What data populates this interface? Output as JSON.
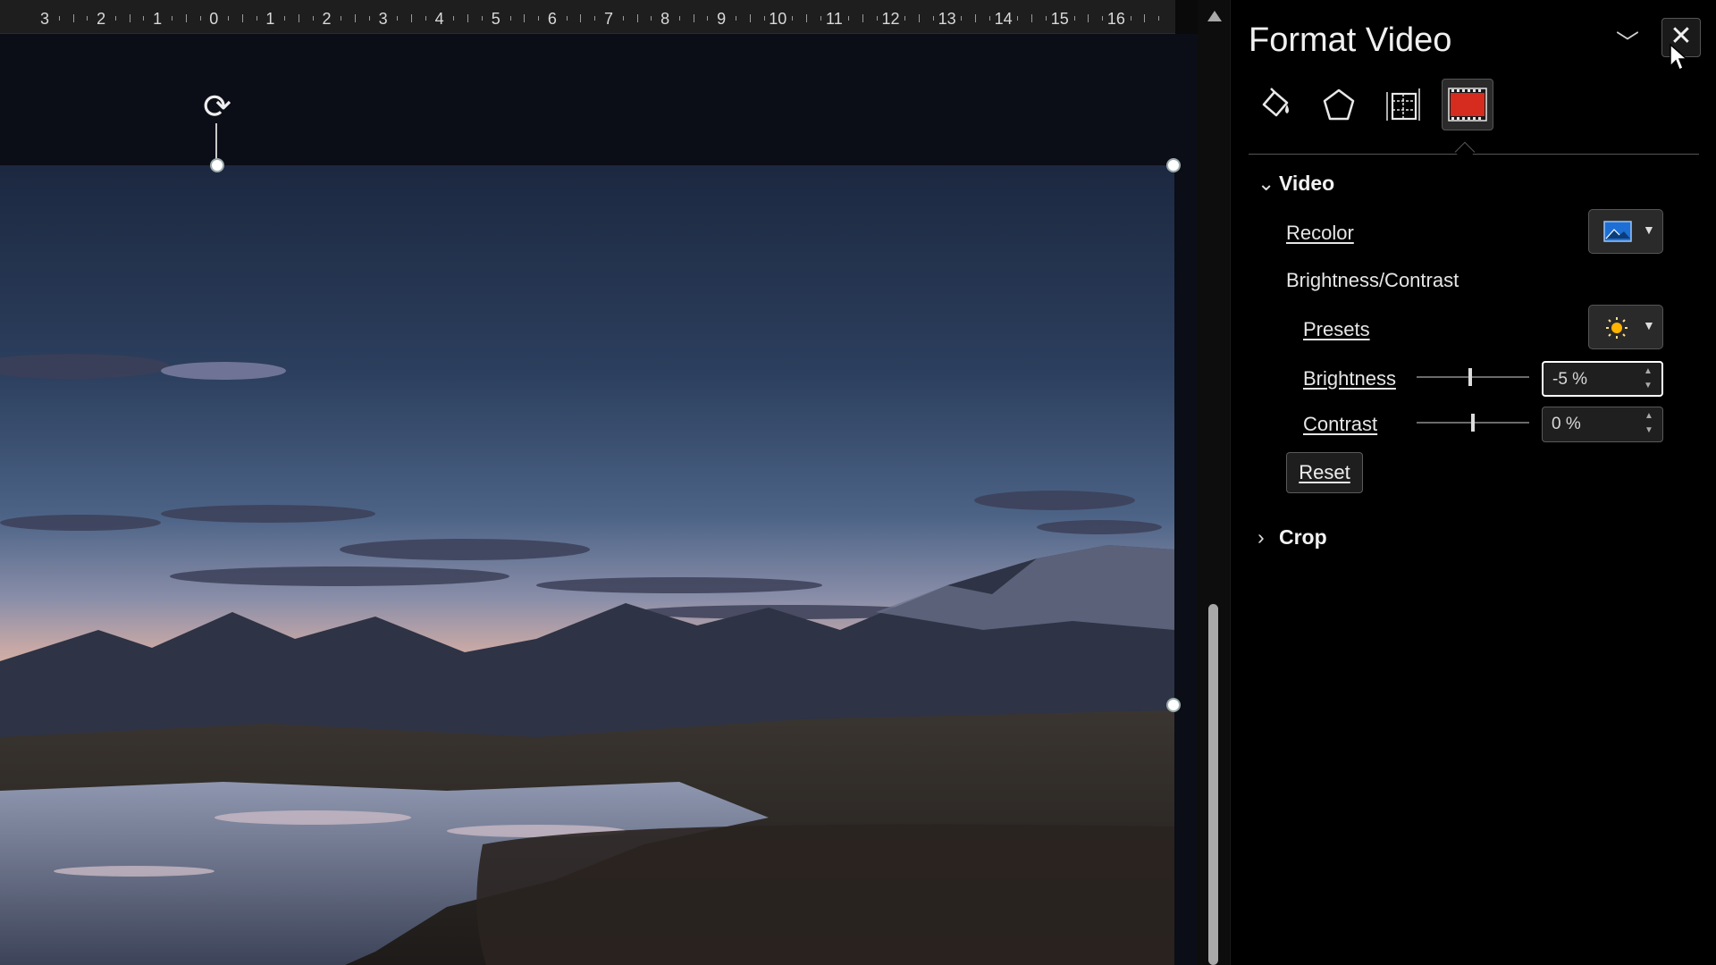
{
  "ruler": {
    "labels": [
      "3",
      "2",
      "1",
      "0",
      "1",
      "2",
      "3",
      "4",
      "5",
      "6",
      "7",
      "8",
      "9",
      "10",
      "11",
      "12",
      "13",
      "14",
      "15",
      "16"
    ]
  },
  "panel": {
    "title": "Format Video",
    "tabs": [
      {
        "icon": "fill-line-icon"
      },
      {
        "icon": "effects-pentagon-icon"
      },
      {
        "icon": "size-properties-icon"
      },
      {
        "icon": "video-icon",
        "active": true
      }
    ],
    "video_section": {
      "label": "Video",
      "expanded": true,
      "recolor_label": "Recolor",
      "brightness_contrast_label": "Brightness/Contrast",
      "presets_label": "Presets",
      "brightness_label": "Brightness",
      "brightness_value": "-5 %",
      "brightness_level": -5,
      "contrast_label": "Contrast",
      "contrast_value": "0 %",
      "contrast_level": 0,
      "reset_label": "Reset"
    },
    "crop_section": {
      "label": "Crop",
      "expanded": false
    }
  },
  "colors": {
    "panel_bg": "#000000",
    "ruler_bg": "#1e1e1e",
    "presets_sun": "#ffb400"
  }
}
